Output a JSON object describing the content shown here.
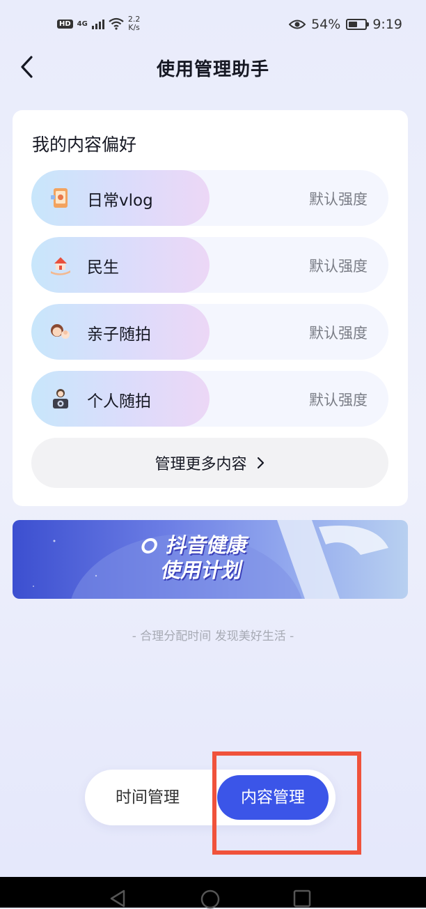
{
  "status_bar": {
    "hd": "HD",
    "network": "4G",
    "speed_value": "2.2",
    "speed_unit": "K/s",
    "battery": "54%",
    "battery_level": 0.54,
    "time": "9:19"
  },
  "header": {
    "title": "使用管理助手"
  },
  "preferences": {
    "title": "我的内容偏好",
    "items": [
      {
        "label": "日常vlog",
        "strength": "默认强度",
        "icon": "phone-vlog-icon"
      },
      {
        "label": "民生",
        "strength": "默认强度",
        "icon": "house-hand-icon"
      },
      {
        "label": "亲子随拍",
        "strength": "默认强度",
        "icon": "family-faces-icon"
      },
      {
        "label": "个人随拍",
        "strength": "默认强度",
        "icon": "camera-person-icon"
      }
    ],
    "manage_more": "管理更多内容"
  },
  "banner": {
    "line1": "抖音健康",
    "line2": "使用计划"
  },
  "footer_note": "- 合理分配时间 发现美好生活 -",
  "tabs": {
    "time": "时间管理",
    "content": "内容管理",
    "active": "content"
  },
  "colors": {
    "accent": "#3b55e8",
    "highlight": "#f0523b",
    "strength_text": "#7a7d86"
  }
}
